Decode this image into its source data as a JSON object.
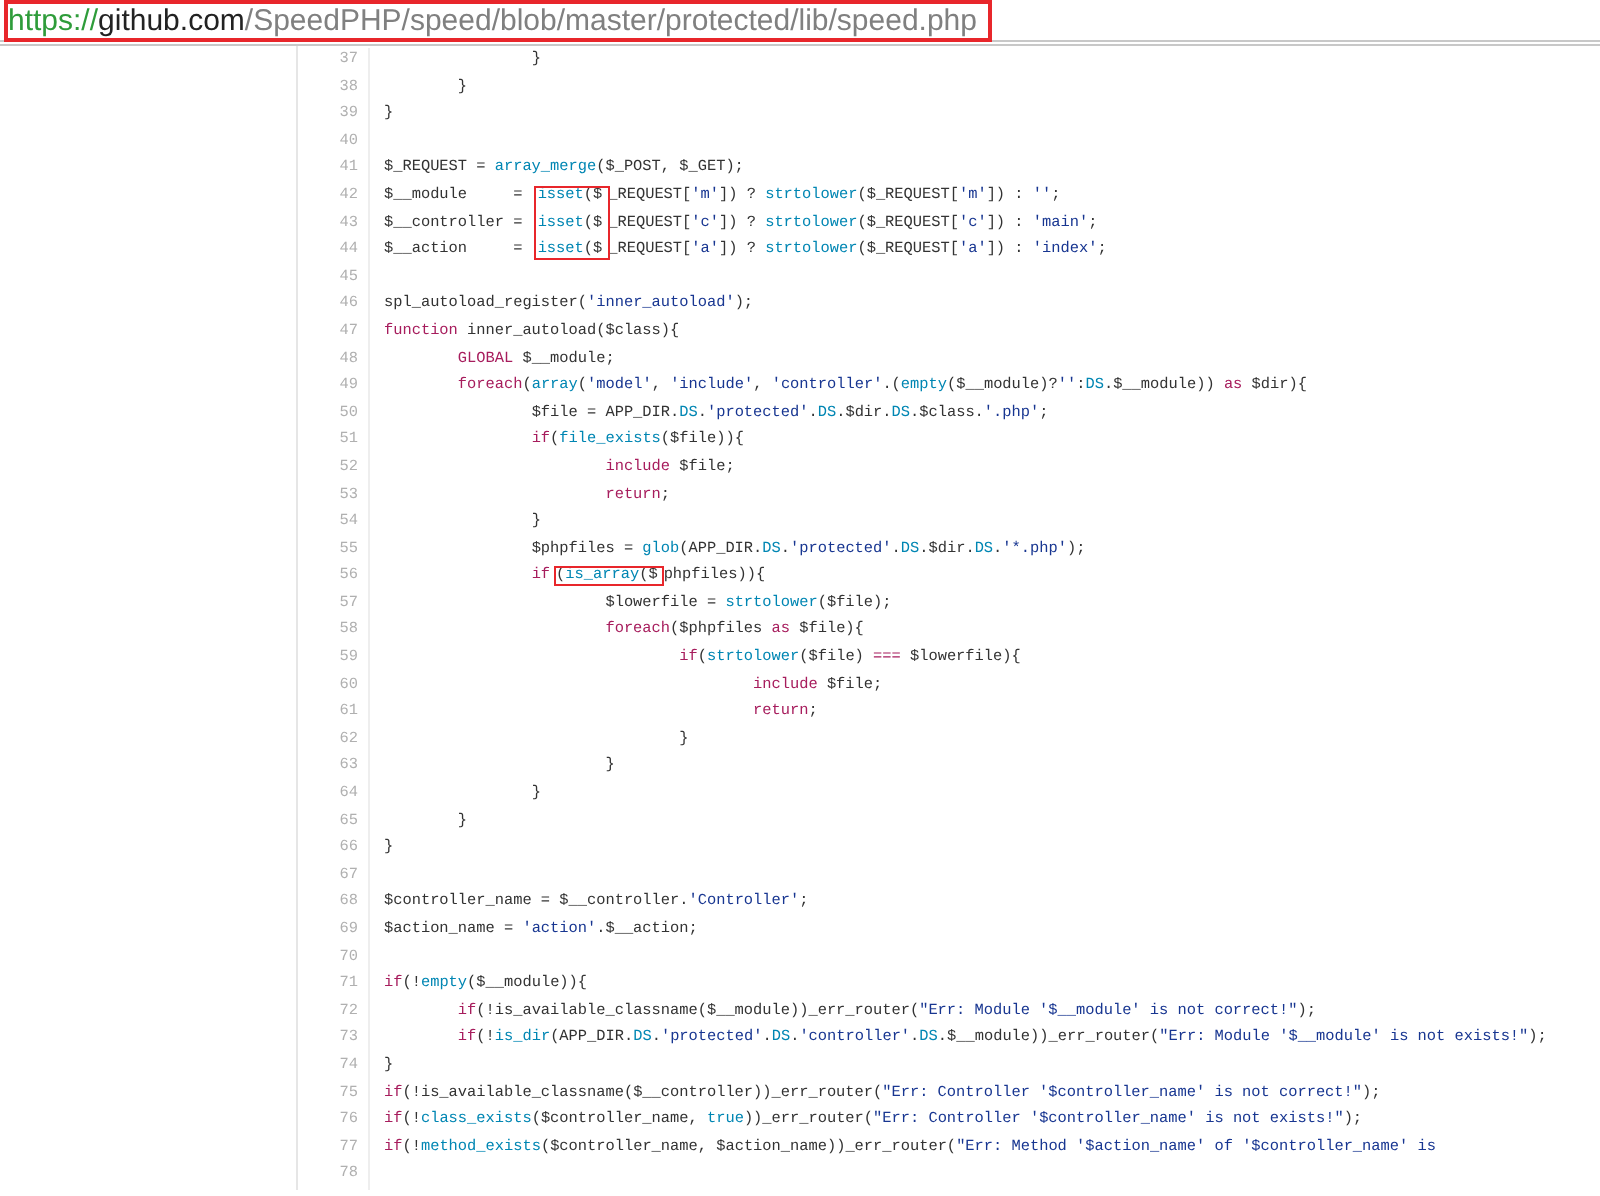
{
  "address_bar": {
    "scheme": "https://",
    "host": "github.com",
    "path": "/SpeedPHP/speed/blob/master/protected/lib/speed.php",
    "highlighted": true
  },
  "lines": [
    {
      "number": "37",
      "tokens": [
        {
          "kind": "plain",
          "text": "\t\t}"
        }
      ]
    },
    {
      "number": "38",
      "tokens": [
        {
          "kind": "plain",
          "text": "\t}"
        }
      ]
    },
    {
      "number": "39",
      "tokens": [
        {
          "kind": "plain",
          "text": "}"
        }
      ]
    },
    {
      "number": "40"
    },
    {
      "number": "41",
      "tokens": [
        {
          "kind": "plain",
          "text": "$_REQUEST = "
        },
        {
          "kind": "builtin",
          "text": "array_merge"
        },
        {
          "kind": "plain",
          "text": "($_POST, $_GET);"
        }
      ]
    },
    {
      "number": "42",
      "tokens": [
        {
          "kind": "plain",
          "text": "$__module     = "
        },
        {
          "kind": "builtin",
          "text": "isset",
          "boxed": true
        },
        {
          "kind": "plain",
          "text": "($",
          "boxed": true
        },
        {
          "kind": "plain",
          "text": "_REQUEST["
        },
        {
          "kind": "string",
          "text": "'m'"
        },
        {
          "kind": "plain",
          "text": "]) ? "
        },
        {
          "kind": "builtin",
          "text": "strtolower"
        },
        {
          "kind": "plain",
          "text": "($_REQUEST["
        },
        {
          "kind": "string",
          "text": "'m'"
        },
        {
          "kind": "plain",
          "text": "]) : "
        },
        {
          "kind": "string",
          "text": "''"
        },
        {
          "kind": "plain",
          "text": ";"
        }
      ]
    },
    {
      "number": "43",
      "tokens": [
        {
          "kind": "plain",
          "text": "$__controller = "
        },
        {
          "kind": "builtin",
          "text": "isset",
          "boxed": true
        },
        {
          "kind": "plain",
          "text": "($",
          "boxed": true
        },
        {
          "kind": "plain",
          "text": "_REQUEST["
        },
        {
          "kind": "string",
          "text": "'c'"
        },
        {
          "kind": "plain",
          "text": "]) ? "
        },
        {
          "kind": "builtin",
          "text": "strtolower"
        },
        {
          "kind": "plain",
          "text": "($_REQUEST["
        },
        {
          "kind": "string",
          "text": "'c'"
        },
        {
          "kind": "plain",
          "text": "]) : "
        },
        {
          "kind": "string",
          "text": "'main'"
        },
        {
          "kind": "plain",
          "text": ";"
        }
      ]
    },
    {
      "number": "44",
      "tokens": [
        {
          "kind": "plain",
          "text": "$__action     = "
        },
        {
          "kind": "builtin",
          "text": "isset",
          "boxed": true
        },
        {
          "kind": "plain",
          "text": "($",
          "boxed": true
        },
        {
          "kind": "plain",
          "text": "_REQUEST["
        },
        {
          "kind": "string",
          "text": "'a'"
        },
        {
          "kind": "plain",
          "text": "]) ? "
        },
        {
          "kind": "builtin",
          "text": "strtolower"
        },
        {
          "kind": "plain",
          "text": "($_REQUEST["
        },
        {
          "kind": "string",
          "text": "'a'"
        },
        {
          "kind": "plain",
          "text": "]) : "
        },
        {
          "kind": "string",
          "text": "'index'"
        },
        {
          "kind": "plain",
          "text": ";"
        }
      ]
    },
    {
      "number": "45"
    },
    {
      "number": "46",
      "tokens": [
        {
          "kind": "plain",
          "text": "spl_autoload_register("
        },
        {
          "kind": "string",
          "text": "'inner_autoload'"
        },
        {
          "kind": "plain",
          "text": ");"
        }
      ]
    },
    {
      "number": "47",
      "tokens": [
        {
          "kind": "keyword",
          "text": "function"
        },
        {
          "kind": "plain",
          "text": " inner_autoload($class){"
        }
      ]
    },
    {
      "number": "48",
      "tokens": [
        {
          "kind": "keyword",
          "text": "\tGLOBAL"
        },
        {
          "kind": "plain",
          "text": " $__module;"
        }
      ]
    },
    {
      "number": "49",
      "tokens": [
        {
          "kind": "keyword",
          "text": "\tforeach"
        },
        {
          "kind": "plain",
          "text": "("
        },
        {
          "kind": "builtin",
          "text": "array"
        },
        {
          "kind": "plain",
          "text": "("
        },
        {
          "kind": "string",
          "text": "'model'"
        },
        {
          "kind": "plain",
          "text": ", "
        },
        {
          "kind": "string",
          "text": "'include'"
        },
        {
          "kind": "plain",
          "text": ", "
        },
        {
          "kind": "string",
          "text": "'controller'"
        },
        {
          "kind": "plain",
          "text": ".("
        },
        {
          "kind": "builtin",
          "text": "empty"
        },
        {
          "kind": "plain",
          "text": "($__module)?"
        },
        {
          "kind": "string",
          "text": "''"
        },
        {
          "kind": "plain",
          "text": ":"
        },
        {
          "kind": "builtin",
          "text": "DS"
        },
        {
          "kind": "plain",
          "text": ".$__module)) "
        },
        {
          "kind": "keyword",
          "text": "as"
        },
        {
          "kind": "plain",
          "text": " $dir){"
        }
      ]
    },
    {
      "number": "50",
      "tokens": [
        {
          "kind": "plain",
          "text": "\t\t$file = APP_DIR."
        },
        {
          "kind": "builtin",
          "text": "DS"
        },
        {
          "kind": "plain",
          "text": "."
        },
        {
          "kind": "string",
          "text": "'protected'"
        },
        {
          "kind": "plain",
          "text": "."
        },
        {
          "kind": "builtin",
          "text": "DS"
        },
        {
          "kind": "plain",
          "text": ".$dir."
        },
        {
          "kind": "builtin",
          "text": "DS"
        },
        {
          "kind": "plain",
          "text": ".$class."
        },
        {
          "kind": "string",
          "text": "'.php'"
        },
        {
          "kind": "plain",
          "text": ";"
        }
      ]
    },
    {
      "number": "51",
      "tokens": [
        {
          "kind": "keyword",
          "text": "\t\tif"
        },
        {
          "kind": "plain",
          "text": "("
        },
        {
          "kind": "builtin",
          "text": "file_exists"
        },
        {
          "kind": "plain",
          "text": "($file)){"
        }
      ]
    },
    {
      "number": "52",
      "tokens": [
        {
          "kind": "keyword",
          "text": "\t\t\tinclude"
        },
        {
          "kind": "plain",
          "text": " $file;"
        }
      ]
    },
    {
      "number": "53",
      "tokens": [
        {
          "kind": "keyword",
          "text": "\t\t\treturn"
        },
        {
          "kind": "plain",
          "text": ";"
        }
      ]
    },
    {
      "number": "54",
      "tokens": [
        {
          "kind": "plain",
          "text": "\t\t}"
        }
      ]
    },
    {
      "number": "55",
      "tokens": [
        {
          "kind": "plain",
          "text": "\t\t$phpfiles = "
        },
        {
          "kind": "builtin",
          "text": "glob"
        },
        {
          "kind": "plain",
          "text": "(APP_DIR."
        },
        {
          "kind": "builtin",
          "text": "DS"
        },
        {
          "kind": "plain",
          "text": "."
        },
        {
          "kind": "string",
          "text": "'protected'"
        },
        {
          "kind": "plain",
          "text": "."
        },
        {
          "kind": "builtin",
          "text": "DS"
        },
        {
          "kind": "plain",
          "text": ".$dir."
        },
        {
          "kind": "builtin",
          "text": "DS"
        },
        {
          "kind": "plain",
          "text": "."
        },
        {
          "kind": "string",
          "text": "'*.php'"
        },
        {
          "kind": "plain",
          "text": ");"
        }
      ]
    },
    {
      "number": "56",
      "tokens": [
        {
          "kind": "keyword",
          "text": "\t\tif"
        },
        {
          "kind": "plain",
          "text": "(",
          "boxed": true
        },
        {
          "kind": "builtin",
          "text": "is_array",
          "boxed": true
        },
        {
          "kind": "plain",
          "text": "($",
          "boxed": true
        },
        {
          "kind": "plain",
          "text": "phpfiles)){"
        }
      ]
    },
    {
      "number": "57",
      "tokens": [
        {
          "kind": "plain",
          "text": "\t\t\t$lowerfile = "
        },
        {
          "kind": "builtin",
          "text": "strtolower"
        },
        {
          "kind": "plain",
          "text": "($file);"
        }
      ]
    },
    {
      "number": "58",
      "tokens": [
        {
          "kind": "keyword",
          "text": "\t\t\tforeach"
        },
        {
          "kind": "plain",
          "text": "($phpfiles "
        },
        {
          "kind": "keyword",
          "text": "as"
        },
        {
          "kind": "plain",
          "text": " $file){"
        }
      ]
    },
    {
      "number": "59",
      "tokens": [
        {
          "kind": "keyword",
          "text": "\t\t\t\tif"
        },
        {
          "kind": "plain",
          "text": "("
        },
        {
          "kind": "builtin",
          "text": "strtolower"
        },
        {
          "kind": "plain",
          "text": "($file) "
        },
        {
          "kind": "keyword",
          "text": "==="
        },
        {
          "kind": "plain",
          "text": " $lowerfile){"
        }
      ]
    },
    {
      "number": "60",
      "tokens": [
        {
          "kind": "keyword",
          "text": "\t\t\t\t\tinclude"
        },
        {
          "kind": "plain",
          "text": " $file;"
        }
      ]
    },
    {
      "number": "61",
      "tokens": [
        {
          "kind": "keyword",
          "text": "\t\t\t\t\treturn"
        },
        {
          "kind": "plain",
          "text": ";"
        }
      ]
    },
    {
      "number": "62",
      "tokens": [
        {
          "kind": "plain",
          "text": "\t\t\t\t}"
        }
      ]
    },
    {
      "number": "63",
      "tokens": [
        {
          "kind": "plain",
          "text": "\t\t\t}"
        }
      ]
    },
    {
      "number": "64",
      "tokens": [
        {
          "kind": "plain",
          "text": "\t\t}"
        }
      ]
    },
    {
      "number": "65",
      "tokens": [
        {
          "kind": "plain",
          "text": "\t}"
        }
      ]
    },
    {
      "number": "66",
      "tokens": [
        {
          "kind": "plain",
          "text": "}"
        }
      ]
    },
    {
      "number": "67"
    },
    {
      "number": "68",
      "tokens": [
        {
          "kind": "plain",
          "text": "$controller_name = $__controller."
        },
        {
          "kind": "string",
          "text": "'Controller'"
        },
        {
          "kind": "plain",
          "text": ";"
        }
      ]
    },
    {
      "number": "69",
      "tokens": [
        {
          "kind": "plain",
          "text": "$action_name = "
        },
        {
          "kind": "string",
          "text": "'action'"
        },
        {
          "kind": "plain",
          "text": ".$__action;"
        }
      ]
    },
    {
      "number": "70"
    },
    {
      "number": "71",
      "tokens": [
        {
          "kind": "keyword",
          "text": "if"
        },
        {
          "kind": "plain",
          "text": "(!"
        },
        {
          "kind": "builtin",
          "text": "empty"
        },
        {
          "kind": "plain",
          "text": "($__module)){"
        }
      ]
    },
    {
      "number": "72",
      "tokens": [
        {
          "kind": "keyword",
          "text": "\tif"
        },
        {
          "kind": "plain",
          "text": "(!is_available_classname($__module))_err_router("
        },
        {
          "kind": "string",
          "text": "\"Err: Module '$__module' is not correct!\""
        },
        {
          "kind": "plain",
          "text": ");"
        }
      ]
    },
    {
      "number": "73",
      "tokens": [
        {
          "kind": "keyword",
          "text": "\tif"
        },
        {
          "kind": "plain",
          "text": "(!"
        },
        {
          "kind": "builtin",
          "text": "is_dir"
        },
        {
          "kind": "plain",
          "text": "(APP_DIR."
        },
        {
          "kind": "builtin",
          "text": "DS"
        },
        {
          "kind": "plain",
          "text": "."
        },
        {
          "kind": "string",
          "text": "'protected'"
        },
        {
          "kind": "plain",
          "text": "."
        },
        {
          "kind": "builtin",
          "text": "DS"
        },
        {
          "kind": "plain",
          "text": "."
        },
        {
          "kind": "string",
          "text": "'controller'"
        },
        {
          "kind": "plain",
          "text": "."
        },
        {
          "kind": "builtin",
          "text": "DS"
        },
        {
          "kind": "plain",
          "text": ".$__module))_err_router("
        },
        {
          "kind": "string",
          "text": "\"Err: Module '$__module' is not exists!\""
        },
        {
          "kind": "plain",
          "text": ");"
        }
      ]
    },
    {
      "number": "74",
      "tokens": [
        {
          "kind": "plain",
          "text": "}"
        }
      ]
    },
    {
      "number": "75",
      "tokens": [
        {
          "kind": "keyword",
          "text": "if"
        },
        {
          "kind": "plain",
          "text": "(!is_available_classname($__controller))_err_router("
        },
        {
          "kind": "string",
          "text": "\"Err: Controller '$controller_name' is not correct!\""
        },
        {
          "kind": "plain",
          "text": ");"
        }
      ]
    },
    {
      "number": "76",
      "tokens": [
        {
          "kind": "keyword",
          "text": "if"
        },
        {
          "kind": "plain",
          "text": "(!"
        },
        {
          "kind": "builtin",
          "text": "class_exists"
        },
        {
          "kind": "plain",
          "text": "($controller_name, "
        },
        {
          "kind": "builtin",
          "text": "true"
        },
        {
          "kind": "plain",
          "text": "))_err_router("
        },
        {
          "kind": "string",
          "text": "\"Err: Controller '$controller_name' is not exists!\""
        },
        {
          "kind": "plain",
          "text": ");"
        }
      ]
    },
    {
      "number": "77",
      "tokens": [
        {
          "kind": "keyword",
          "text": "if"
        },
        {
          "kind": "plain",
          "text": "(!"
        },
        {
          "kind": "builtin",
          "text": "method_exists"
        },
        {
          "kind": "plain",
          "text": "($controller_name, $action_name))_err_router("
        },
        {
          "kind": "string",
          "text": "\"Err: Method '$action_name' of '$controller_name' is"
        }
      ]
    },
    {
      "number": "78"
    }
  ]
}
